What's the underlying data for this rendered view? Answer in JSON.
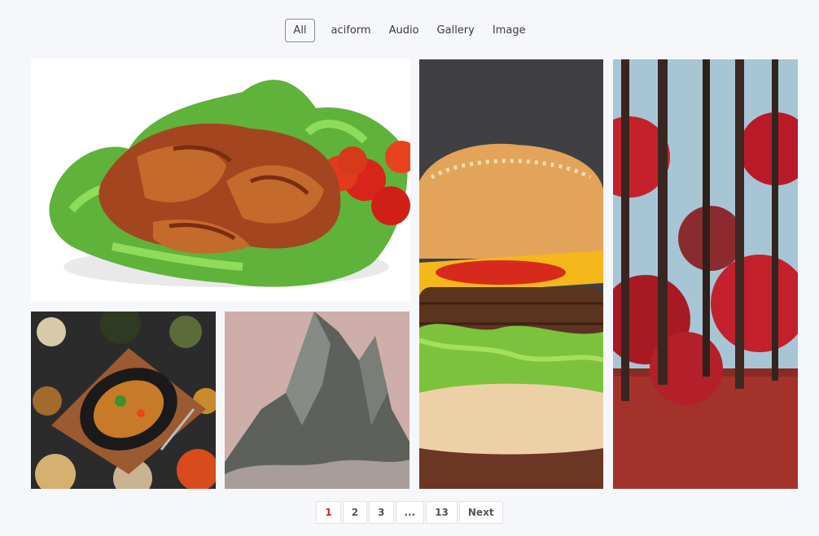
{
  "filters": [
    {
      "label": "All",
      "active": true
    },
    {
      "label": "aciform",
      "active": false
    },
    {
      "label": "Audio",
      "active": false
    },
    {
      "label": "Gallery",
      "active": false
    },
    {
      "label": "Image",
      "active": false
    }
  ],
  "gallery": {
    "items": [
      {
        "image": "grilled-chicken-wings-photo"
      },
      {
        "image": "burger-photo"
      },
      {
        "image": "red-forest-photo"
      },
      {
        "image": "roast-chicken-platter-photo"
      },
      {
        "image": "mountain-peak-photo"
      }
    ]
  },
  "pagination": {
    "pages": [
      "1",
      "2",
      "3",
      "...",
      "13"
    ],
    "current": "1",
    "next_label": "Next"
  }
}
